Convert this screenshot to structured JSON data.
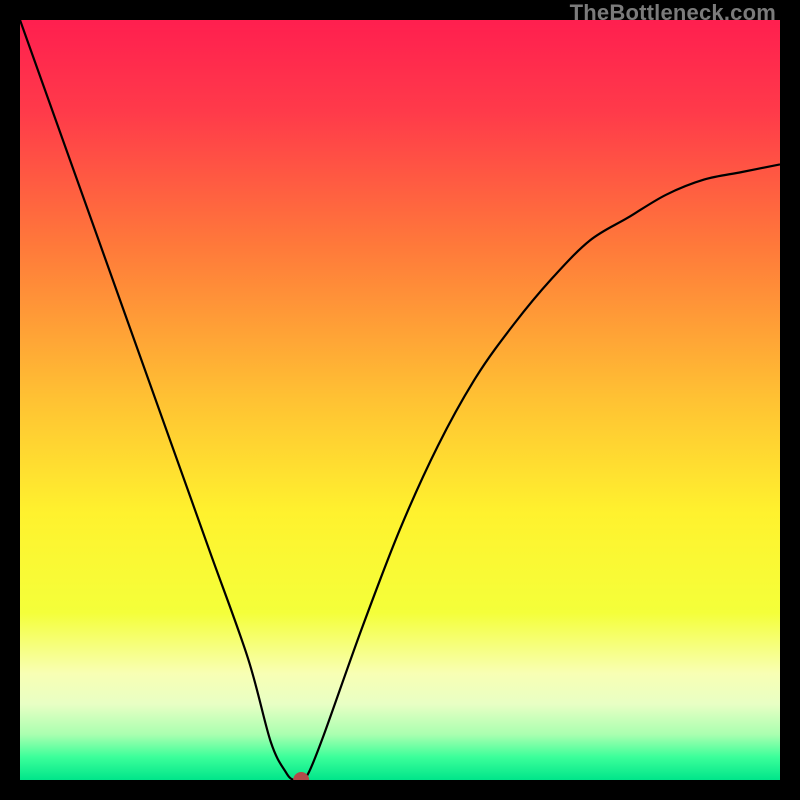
{
  "watermark": "TheBottleneck.com",
  "chart_data": {
    "type": "line",
    "title": "",
    "xlabel": "",
    "ylabel": "",
    "xlim": [
      0,
      100
    ],
    "ylim": [
      0,
      100
    ],
    "x": [
      0,
      5,
      10,
      15,
      20,
      25,
      30,
      33,
      35,
      36,
      37,
      38,
      40,
      45,
      50,
      55,
      60,
      65,
      70,
      75,
      80,
      85,
      90,
      95,
      100
    ],
    "y": [
      100,
      86,
      72,
      58,
      44,
      30,
      16,
      5,
      1,
      0,
      0,
      1,
      6,
      20,
      33,
      44,
      53,
      60,
      66,
      71,
      74,
      77,
      79,
      80,
      81
    ],
    "marker": {
      "x": 37,
      "y": 0,
      "color": "#b24a4a",
      "radius": 8
    },
    "background": {
      "type": "vertical_gradient",
      "stops": [
        {
          "offset": 0.0,
          "color": "#ff1f4f"
        },
        {
          "offset": 0.12,
          "color": "#ff3a4a"
        },
        {
          "offset": 0.3,
          "color": "#ff7a3a"
        },
        {
          "offset": 0.5,
          "color": "#ffc233"
        },
        {
          "offset": 0.65,
          "color": "#fff22e"
        },
        {
          "offset": 0.78,
          "color": "#f4ff3a"
        },
        {
          "offset": 0.86,
          "color": "#f8ffb4"
        },
        {
          "offset": 0.9,
          "color": "#e8ffc4"
        },
        {
          "offset": 0.94,
          "color": "#aaffb0"
        },
        {
          "offset": 0.97,
          "color": "#3bff9a"
        },
        {
          "offset": 1.0,
          "color": "#00e58a"
        }
      ]
    },
    "curve_color": "#000000",
    "curve_width": 2.2
  }
}
